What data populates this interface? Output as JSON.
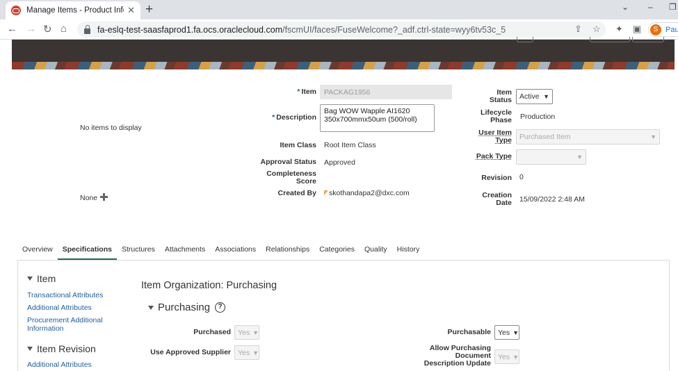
{
  "browser": {
    "tab_title": "Manage Items - Product Informa",
    "tab_close": "✕",
    "new_tab": "+",
    "url_host": "fa-eslq-test-saasfaprod1.fa.ocs.oraclecloud.com",
    "url_path": "/fscmUI/faces/FuseWelcome?_adf.ctrl-state=wyy6tv53c_5",
    "profile_initial": "S",
    "profile_label": "Paus"
  },
  "overview": {
    "no_items": "No items to display",
    "none_label": "None",
    "item_label": "Item",
    "item_value": "PACKAG1956",
    "description_label": "Description",
    "description_value": "Bag WOW Wapple AI1620\n350x700mmx50um (500/roll)",
    "item_class_label": "Item Class",
    "item_class_value": "Root Item Class",
    "approval_status_label": "Approval Status",
    "approval_status_value": "Approved",
    "completeness_label": "Completeness",
    "completeness_label2": "Score",
    "created_by_label": "Created By",
    "created_by_value": "skothandapa2@dxc.com",
    "item_status_label": "Item",
    "item_status_label2": "Status",
    "item_status_value": "Active",
    "lifecycle_label": "Lifecycle",
    "lifecycle_label2": "Phase",
    "lifecycle_value": "Production",
    "user_item_type_label": "User Item",
    "user_item_type_label2": "Type",
    "user_item_type_value": "Purchased Item",
    "pack_type_label": "Pack Type",
    "pack_type_value": "",
    "revision_label": "Revision",
    "revision_value": "0",
    "creation_date_label": "Creation",
    "creation_date_label2": "Date",
    "creation_date_value": "15/09/2022 2:48 AM"
  },
  "tabs": [
    "Overview",
    "Specifications",
    "Structures",
    "Attachments",
    "Associations",
    "Relationships",
    "Categories",
    "Quality",
    "History"
  ],
  "active_tab": "Specifications",
  "left_panel": {
    "item_heading": "Item",
    "links": [
      "Transactional Attributes",
      "Additional Attributes",
      "Procurement Additional Information"
    ],
    "revision_heading": "Item Revision",
    "revision_link": "Additional Attributes"
  },
  "main": {
    "org_title": "Item Organization: Purchasing",
    "section_title": "Purchasing",
    "help": "?",
    "purchased_label": "Purchased",
    "purchased_value": "Yes",
    "use_approved_supplier_label": "Use Approved Supplier",
    "use_approved_supplier_value": "Yes",
    "purchasable_label": "Purchasable",
    "purchasable_value": "Yes",
    "allow_doc_label": "Allow Purchasing Document Description Update",
    "allow_doc_value": "Yes"
  },
  "colors": {
    "header_bg": "#3a3432",
    "link": "#1f5e9c",
    "active_tab_underline": "#1f6b4f",
    "oracle_red": "#c74634"
  }
}
